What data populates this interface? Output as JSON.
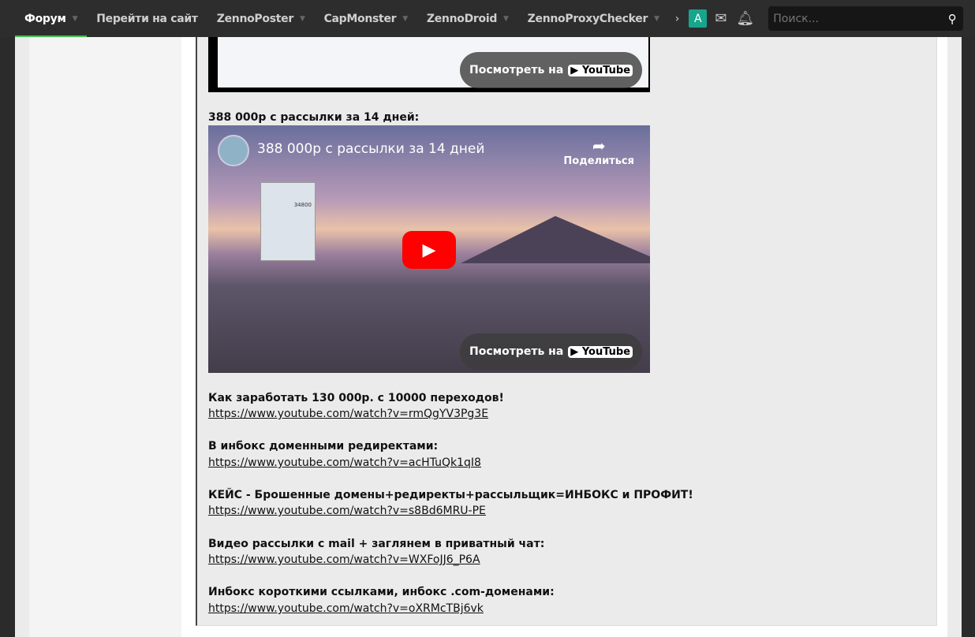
{
  "nav": {
    "items": [
      {
        "label": "Форум",
        "caret": true,
        "active": true
      },
      {
        "label": "Перейти на сайт",
        "caret": false
      },
      {
        "label": "ZennoPoster",
        "caret": true
      },
      {
        "label": "CapMonster",
        "caret": true
      },
      {
        "label": "ZennoDroid",
        "caret": true
      },
      {
        "label": "ZennoProxyChecker",
        "caret": true
      }
    ],
    "more": "›",
    "avatar": "A",
    "search_placeholder": "Поиск..."
  },
  "videos": [
    {
      "watch_label": "Посмотреть на",
      "yt": "▶ YouTube"
    },
    {
      "heading": "388 000р с рассылки за 14 дней:",
      "title": "388 000р с рассылки за 14 дней",
      "share": "Поделиться",
      "calc_value": "34800",
      "watch_label": "Посмотреть на",
      "yt": "▶ YouTube"
    }
  ],
  "links": [
    {
      "title": "Как заработать 130 000р. с 10000 переходов!",
      "url": "https://www.youtube.com/watch?v=rmQgYV3Pg3E"
    },
    {
      "title": "В инбокс доменными редиректами:",
      "url": "https://www.youtube.com/watch?v=acHTuQk1qI8"
    },
    {
      "title": "КЕЙС - Брошенные домены+редиректы+рассыльщик=ИНБОКС и ПРОФИТ!",
      "url": "https://www.youtube.com/watch?v=s8Bd6MRU-PE"
    },
    {
      "title": "Видео рассылки с mail + заглянем в приватный чат:",
      "url": "https://www.youtube.com/watch?v=WXFoJJ6_P6A"
    },
    {
      "title": "Инбокс короткими ссылками, инбокс .com-доменами:",
      "url": "https://www.youtube.com/watch?v=oXRMcTBj6vk"
    }
  ]
}
